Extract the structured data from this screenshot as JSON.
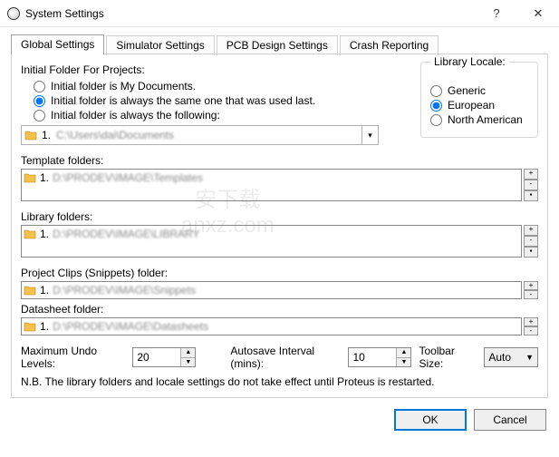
{
  "window": {
    "title": "System Settings"
  },
  "tabs": [
    "Global Settings",
    "Simulator Settings",
    "PCB Design Settings",
    "Crash Reporting"
  ],
  "initial_folder": {
    "label": "Initial Folder For Projects:",
    "opt1": "Initial folder is My Documents.",
    "opt2": "Initial folder is always the same one that was used last.",
    "opt3": "Initial folder is always the following:",
    "path_index": "1.",
    "path_value": "C:\\Users\\dai\\Documents"
  },
  "locale": {
    "label": "Library Locale:",
    "opt1": "Generic",
    "opt2": "European",
    "opt3": "North American"
  },
  "template_folders": {
    "label": "Template folders:",
    "items": [
      {
        "index": "1.",
        "path": "D:\\PRODEV\\IMAGE\\Templates"
      }
    ]
  },
  "library_folders": {
    "label": "Library folders:",
    "items": [
      {
        "index": "1.",
        "path": "D:\\PRODEV\\IMAGE\\LIBRARY"
      }
    ]
  },
  "snippets": {
    "label": "Project Clips (Snippets) folder:",
    "path_index": "1.",
    "path_value": "D:\\PRODEV\\IMAGE\\Snippets"
  },
  "datasheet": {
    "label": "Datasheet folder:",
    "path_index": "1.",
    "path_value": "D:\\PRODEV\\IMAGE\\Datasheets"
  },
  "undo": {
    "label": "Maximum Undo Levels:",
    "value": "20"
  },
  "autosave": {
    "label": "Autosave Interval (mins):",
    "value": "10"
  },
  "toolbar": {
    "label": "Toolbar Size:",
    "value": "Auto"
  },
  "note": "N.B. The library folders and locale settings do not take effect until Proteus is restarted.",
  "buttons": {
    "ok": "OK",
    "cancel": "Cancel"
  }
}
